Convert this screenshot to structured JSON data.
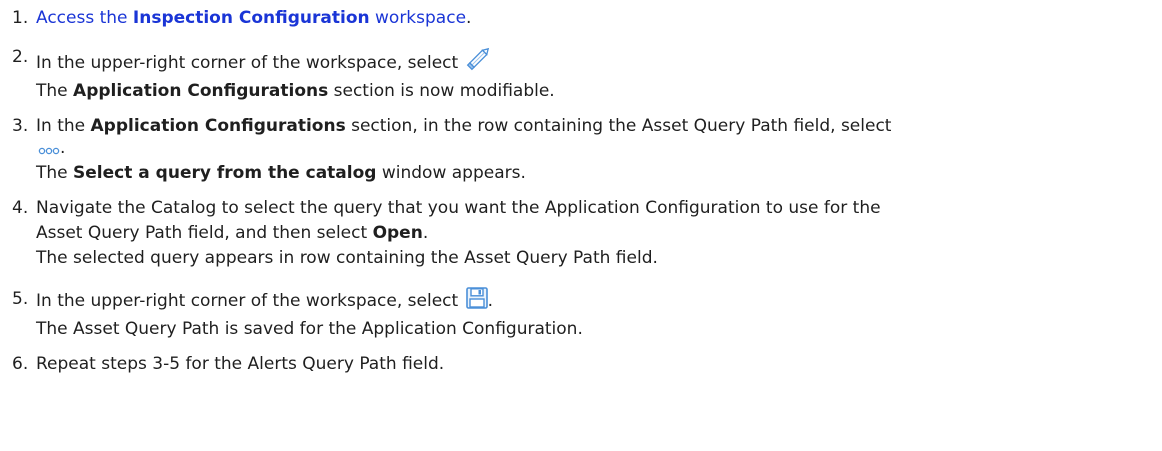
{
  "steps": [
    {
      "number": "1.",
      "link_before": "Access the ",
      "link_bold": "Inspection Configuration",
      "link_after": " workspace",
      "text_after": "."
    },
    {
      "number": "2.",
      "text": "In the upper-right corner of the workspace, select ",
      "icon": "pencil-edit-icon",
      "result": " section is now modifiable.",
      "result_before": "The ",
      "result_bold": "Application Configurations"
    },
    {
      "number": "3.",
      "text_before": "In the ",
      "text_bold": "Application Configurations",
      "text_after": " section, in the row containing the Asset Query Path field, select",
      "icon": "ellipsis-icon",
      "after_icon": ".",
      "result_before": "The ",
      "result_bold": "Select a query from the catalog",
      "result_after": " window appears."
    },
    {
      "number": "4.",
      "text_line1": "Navigate the Catalog to select the query that you want the Application Configuration to use for the",
      "text_line2_before": "Asset Query Path field, and then select ",
      "text_line2_bold": "Open",
      "text_line2_after": ".",
      "result": "The selected query appears in row containing the Asset Query Path field."
    },
    {
      "number": "5.",
      "text": "In the upper-right corner of the workspace, select ",
      "icon": "save-icon",
      "after_icon": ".",
      "result": "The Asset Query Path is saved for the Application Configuration."
    },
    {
      "number": "6.",
      "text": "Repeat steps 3-5 for the Alerts Query Path field."
    }
  ],
  "colors": {
    "link": "#1a35d6",
    "icon_blue": "#4a8fd8",
    "text": "#1f1f1f"
  }
}
